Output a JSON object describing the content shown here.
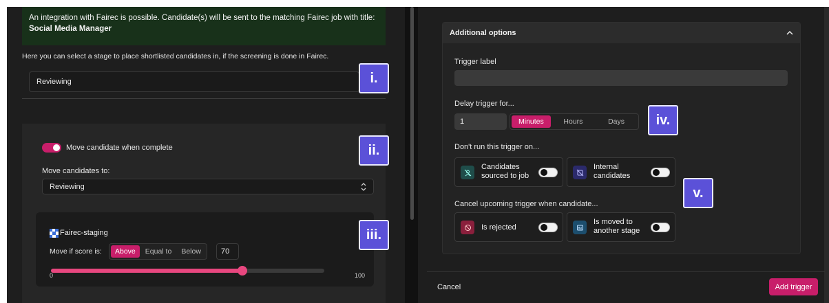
{
  "left": {
    "info": {
      "text": "An integration with Fairec is possible. Candidate(s) will be sent to the matching Fairec job with title:",
      "job_title": "Social Media Manager"
    },
    "stage_help": "Here you can select a stage to place shortlisted candidates in, if the screening is done in Fairec.",
    "stage_value": "Reviewing",
    "move_card": {
      "toggle_label": "Move candidate when complete",
      "toggle_on": true,
      "move_to_label": "Move candidates to:",
      "move_to_value": "Reviewing",
      "chevron": "⌃⌄"
    },
    "fairec": {
      "name": "Fairec-staging",
      "score_label": "Move if score is:",
      "options": [
        "Above",
        "Equal to",
        "Below"
      ],
      "selected_option": "Above",
      "score_value": "70",
      "slider_min": "0",
      "slider_max": "100",
      "slider_value": 70
    }
  },
  "annotations": [
    "i.",
    "ii.",
    "iii.",
    "iv.",
    "v."
  ],
  "right": {
    "section_title": "Additional options",
    "collapse_glyph": "^",
    "trigger_label": "Trigger label",
    "trigger_value": "",
    "delay_label": "Delay trigger for...",
    "delay_value": "1",
    "delay_units": [
      "Minutes",
      "Hours",
      "Days"
    ],
    "delay_selected": "Minutes",
    "dont_run_label": "Don't run this trigger on...",
    "dont_run": [
      {
        "line1": "Candidates",
        "line2": "sourced to job",
        "icon": "user-off-icon",
        "on": false
      },
      {
        "line1": "Internal",
        "line2": "candidates",
        "icon": "internal-off-icon",
        "on": false
      }
    ],
    "cancel_label": "Cancel upcoming trigger when candidate...",
    "cancel_rules": [
      {
        "line1": "Is rejected",
        "line2": "",
        "icon": "ban-icon",
        "on": false
      },
      {
        "line1": "Is moved to",
        "line2": "another stage",
        "icon": "stage-icon",
        "on": false
      }
    ],
    "footer": {
      "cancel": "Cancel",
      "add": "Add trigger"
    }
  },
  "colors": {
    "accent": "#c81e6a",
    "annotation": "#5b51d8",
    "info_bg": "#18311a",
    "panel": "#1e1e1e"
  }
}
